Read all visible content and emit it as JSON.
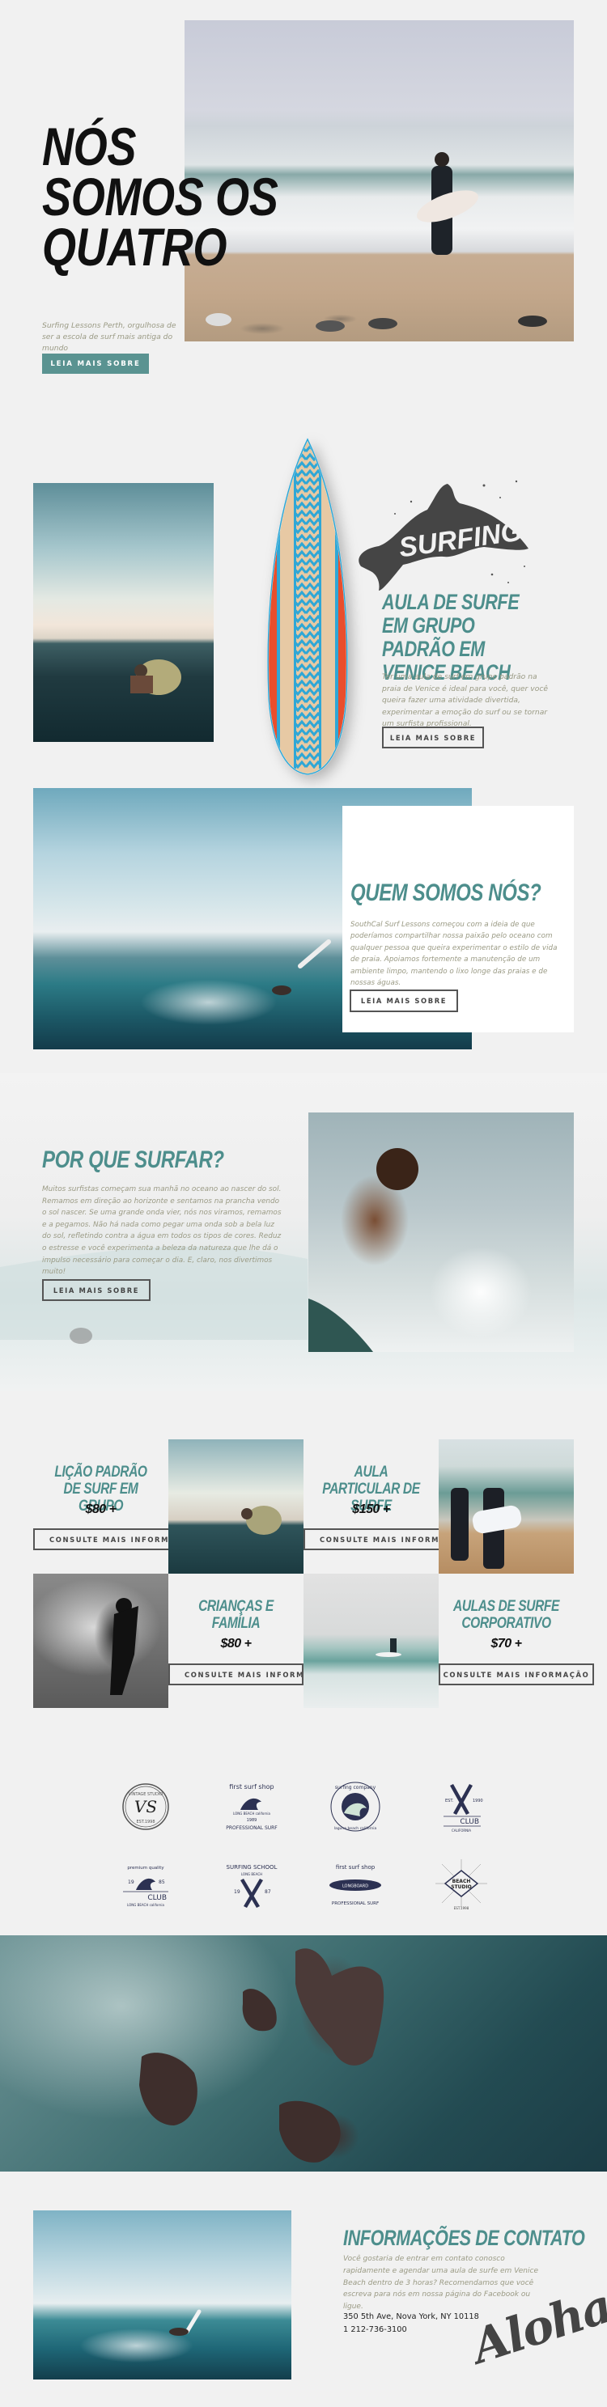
{
  "hero": {
    "title_lines": [
      "Nós",
      "somos os",
      "quatro"
    ],
    "subtitle": "Surfing Lessons Perth, orgulhosa de ser a escola de surf mais antiga do mundo",
    "button_label": "LEIA MAIS SOBRE",
    "image_alt": "surfer-on-beach-photo"
  },
  "group_lesson": {
    "badge_text": "SURFING",
    "title": "Aula de surfe em grupo padrão em Venice Beach",
    "body": "Ter uma aula de surf em grupo padrão na praia de Venice é ideal para você, quer você queira fazer uma atividade divertida, experimentar a emoção do surf ou se tornar um surfista profissional.",
    "button_label": "LEIA MAIS SOBRE"
  },
  "about": {
    "title": "Quem somos nós?",
    "body": "SouthCal Surf Lessons começou com a ideia de que poderíamos compartilhar nossa paixão pelo oceano com qualquer pessoa que queira experimentar o estilo de vida de praia. Apoiamos fortemente a manutenção de um ambiente limpo, mantendo o lixo longe das praias e de nossas águas.",
    "button_label": "LEIA MAIS SOBRE"
  },
  "why": {
    "title": "Por que surfar?",
    "body": "Muitos surfistas começam sua manhã no oceano ao nascer do sol. Remamos em direção ao horizonte e sentamos na prancha vendo o sol nascer. Se uma grande onda vier, nós nos viramos, remamos e a pegamos. Não há nada como pegar uma onda sob a bela luz do sol, refletindo contra a água em todos os tipos de cores. Reduz o estresse e você experimenta a beleza da natureza que lhe dá o impulso necessário para começar o dia. E, claro, nos divertimos muito!",
    "button_label": "LEIA MAIS SOBRE"
  },
  "pricing": {
    "items": [
      {
        "title": "Lição padrão de surf em grupo",
        "price": "$80 +",
        "button_label": "CONSULTE MAIS INFORMAÇÃO"
      },
      {
        "title": "Aula particular de surfe",
        "price": "$150 +",
        "button_label": "CONSULTE MAIS INFORMAÇÃO"
      },
      {
        "title": "Crianças e família",
        "price": "$80 +",
        "button_label": "CONSULTE MAIS INFORMAÇÃO"
      },
      {
        "title": "Aulas de surfe corporativo",
        "price": "$70 +",
        "button_label": "CONSULTE MAIS INFORMAÇÃO"
      }
    ]
  },
  "logos": {
    "items": [
      {
        "name": "vintage-studio",
        "lines": [
          "VINTAGE STUDIO",
          "VS",
          "EST.1998"
        ]
      },
      {
        "name": "first-surf-shop-1989",
        "lines": [
          "first surf shop",
          "LONG BEACH california",
          "1989",
          "PROFESSIONAL SURF"
        ]
      },
      {
        "name": "surfing-company",
        "lines": [
          "surfing company",
          "laguna beach california"
        ]
      },
      {
        "name": "club-california-1990",
        "lines": [
          "EST.",
          "1990",
          "CLUB",
          "CALIFORNIA"
        ]
      },
      {
        "name": "premium-quality-club",
        "lines": [
          "premium quality",
          "19",
          "85",
          "CLUB",
          "LONG BEACH california"
        ]
      },
      {
        "name": "surfing-school",
        "lines": [
          "SURFING SCHOOL",
          "LONG BEACH",
          "19",
          "87"
        ]
      },
      {
        "name": "first-surf-shop-longboard",
        "lines": [
          "first surf shop",
          "LONGBOARD",
          "PROFESSIONAL SURF"
        ]
      },
      {
        "name": "beach-studio",
        "lines": [
          "BEACH",
          "STUDIO",
          "EST.1998"
        ]
      }
    ]
  },
  "contact": {
    "title": "Informações de contato",
    "body": "Você gostaria de entrar em contato conosco rapidamente e agendar uma aula de surfe em Venice Beach dentro de 3 horas? Recomendamos que você escreva para nós em nossa página do Facebook ou ligue.",
    "address": "350 5th Ave, Nova York, NY 10118",
    "phone": "1 212-736-3100",
    "signature": "Aloha"
  },
  "colors": {
    "accent_teal": "#4d8e8c",
    "button_teal": "#5a9391",
    "page_bg": "#f1f1f1",
    "body_text": "#9a9a84",
    "dark": "#111111"
  }
}
